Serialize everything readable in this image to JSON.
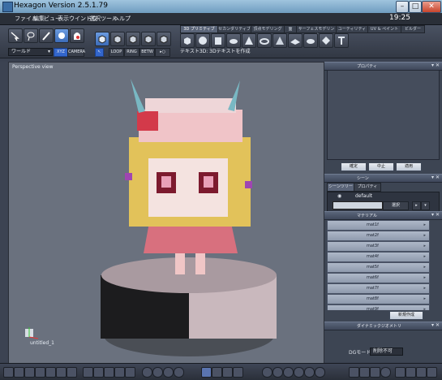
{
  "window": {
    "title": "Hexagon Version 2.5.1.79"
  },
  "menu": {
    "items": [
      "ファイル",
      "編集",
      "ビュー",
      "表示",
      "ウインドウ",
      "選択",
      "ツール",
      "ヘルプ"
    ],
    "clock": "19:25"
  },
  "toolbar": {
    "coord_dropdown": "ワールド",
    "xyz_label": "XYZ",
    "camera_label": "CAMERA",
    "loop_label": "LOOP",
    "ring_label": "RING",
    "betw_label": "BETW",
    "tabs": [
      "3D プリミティブ",
      "セカンダリティブ",
      "頂点モデリング",
      "面",
      "サーフェスモデリング",
      "ユーティリティ",
      "UV & ペイント",
      "ビルダー"
    ],
    "hint": "テキスト3D: 3Dテキストを作成"
  },
  "viewport": {
    "label": "Perspective view",
    "object_name": "untitled_1"
  },
  "panels": {
    "properties": {
      "title": "プロパティ",
      "buttons": {
        "confirm": "確定",
        "cancel": "中止",
        "apply": "適用"
      }
    },
    "scene": {
      "title": "シーン",
      "tabs": [
        "シーンツリー",
        "プロパティ"
      ],
      "default_label": "default",
      "select_label": "選択"
    },
    "material": {
      "title": "マテリアル",
      "items": [
        "mat1f",
        "mat2f",
        "mat3f",
        "mat4f",
        "mat5f",
        "mat6f",
        "mat7f",
        "mat8f",
        "mat9f"
      ],
      "new_button": "新規作成"
    },
    "dynamic": {
      "title": "ダイナミックジオメトリ",
      "dg_mode_label": "DGモード:",
      "dg_mode_value": "削除不可"
    }
  },
  "colors": {
    "accent": "#3366cc",
    "viewport_bg": "#6a717e",
    "panel_bg": "#3d4553"
  }
}
